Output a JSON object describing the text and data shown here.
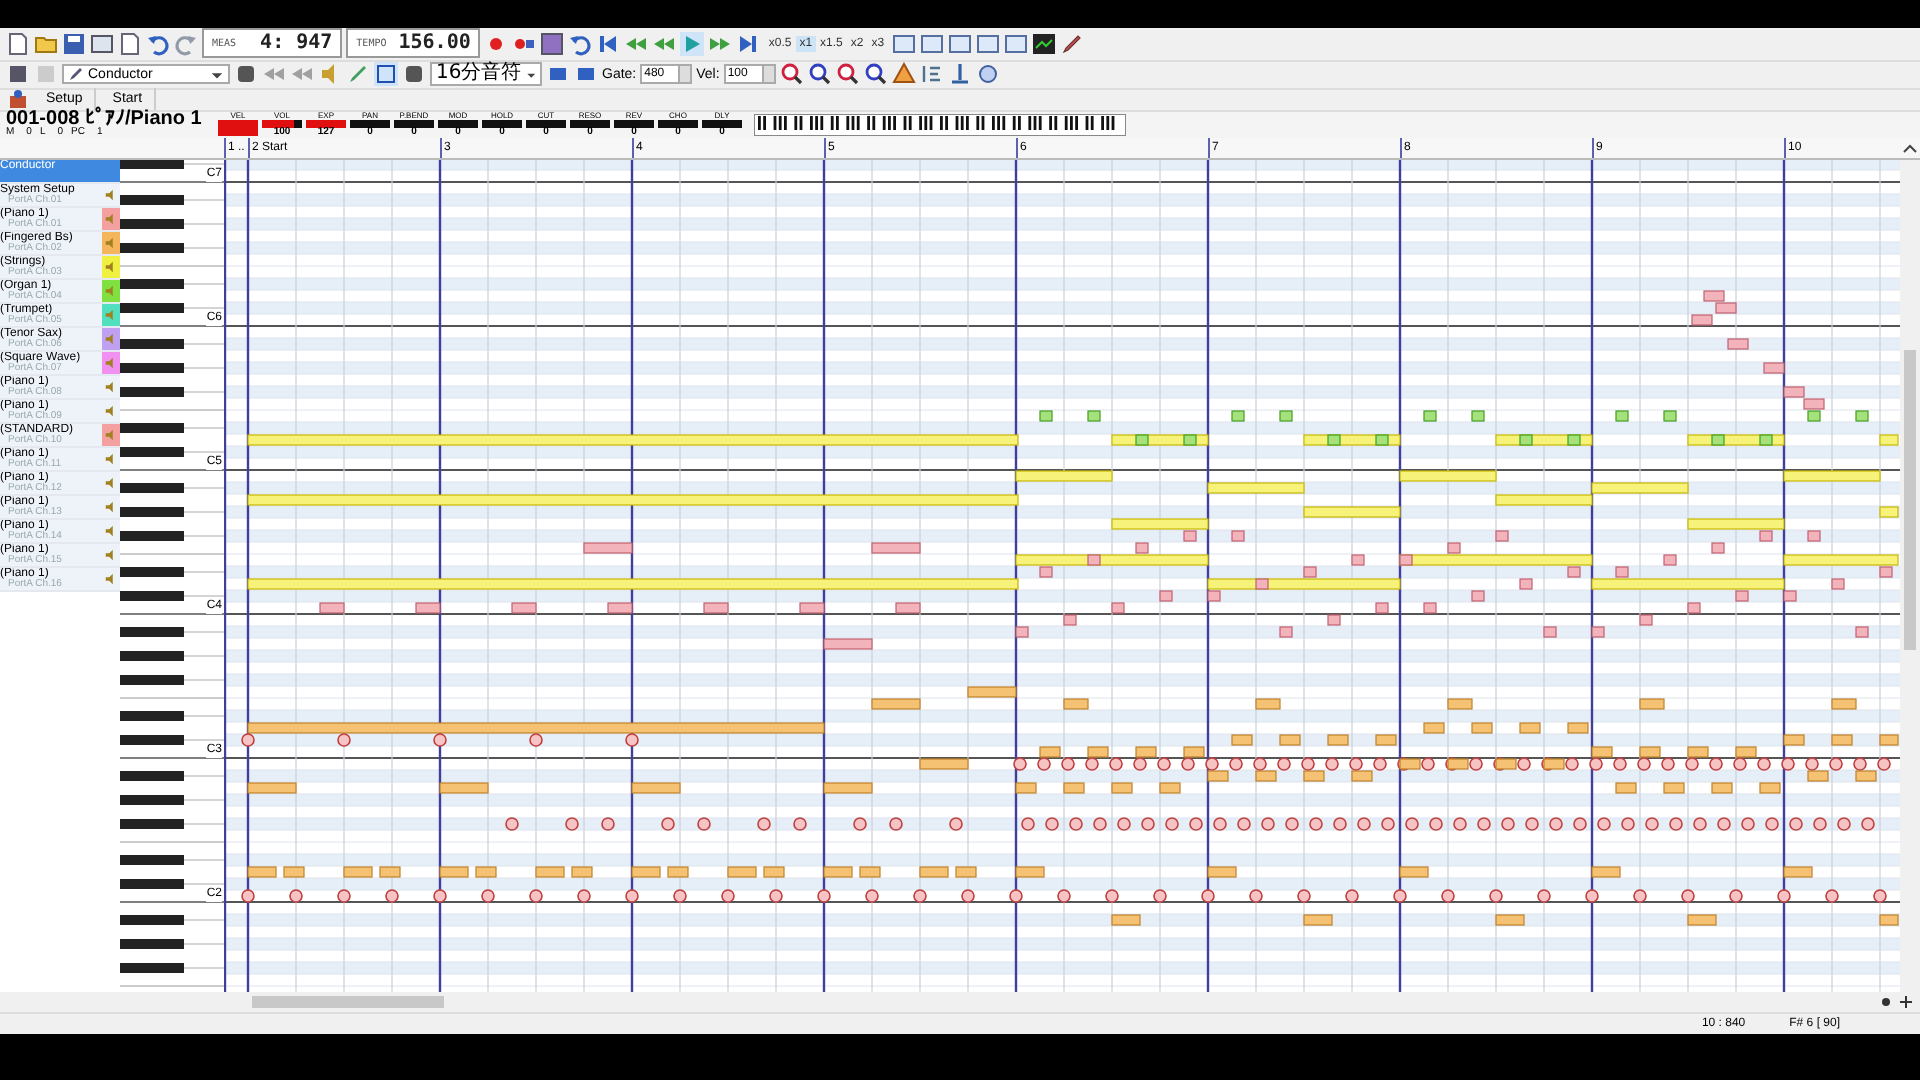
{
  "toolbar": {
    "measure_label": "MEAS",
    "measure": "4: 947",
    "tempo_label": "TEMPO",
    "tempo": "156.00",
    "speeds": [
      {
        "label": "x0.5",
        "selected": false
      },
      {
        "label": "x1",
        "selected": true
      },
      {
        "label": "x1.5",
        "selected": false
      },
      {
        "label": "x2",
        "selected": false
      },
      {
        "label": "x3",
        "selected": false
      }
    ]
  },
  "edit_bar": {
    "track": "Conductor",
    "note_length": "16分音符",
    "gate_label": "Gate:",
    "gate": "480",
    "vel_label": "Vel:",
    "vel": "100"
  },
  "markers": [
    {
      "label": "Setup"
    },
    {
      "label": "Start"
    }
  ],
  "channel_panel": {
    "title": "001-008 ﾋﾟｱﾉ/Piano 1",
    "fields": [
      {
        "label": "M",
        "value": "0"
      },
      {
        "label": "L",
        "value": "0"
      },
      {
        "label": "PC",
        "value": "1"
      }
    ],
    "controls": [
      {
        "label": "VEL",
        "level": 1
      },
      {
        "label": "VOL",
        "value": "100",
        "level": 0.79
      },
      {
        "label": "EXP",
        "value": "127",
        "level": 1
      },
      {
        "label": "PAN",
        "value": "0",
        "level": 0
      },
      {
        "label": "P.BEND",
        "value": "0",
        "level": 0
      },
      {
        "label": "MOD",
        "value": "0",
        "level": 0
      },
      {
        "label": "HOLD",
        "value": "0",
        "level": 0
      },
      {
        "label": "CUT",
        "value": "0",
        "level": 0
      },
      {
        "label": "RESO",
        "value": "0",
        "level": 0
      },
      {
        "label": "REV",
        "value": "0",
        "level": 0
      },
      {
        "label": "CHO",
        "value": "0",
        "level": 0
      },
      {
        "label": "DLY",
        "value": "0",
        "level": 0
      }
    ]
  },
  "tracks": [
    {
      "name": "Conductor",
      "selected": true
    },
    {
      "name": "System Setup",
      "port": "PortA  Ch.01",
      "selected": false
    },
    {
      "name": "(Piano 1)",
      "port": "PortA  Ch.01",
      "selected": false,
      "color": "#f4a0a0"
    },
    {
      "name": "(Fingered Bs)",
      "port": "PortA  Ch.02",
      "selected": false,
      "color": "#f5b55a"
    },
    {
      "name": "(Strings)",
      "port": "PortA  Ch.03",
      "selected": false,
      "color": "#f0f040"
    },
    {
      "name": "(Organ 1)",
      "port": "PortA  Ch.04",
      "selected": false,
      "color": "#80e040"
    },
    {
      "name": "(Trumpet)",
      "port": "PortA  Ch.05",
      "selected": false,
      "color": "#50e0c0"
    },
    {
      "name": "(Tenor Sax)",
      "port": "PortA  Ch.06",
      "selected": false,
      "color": "#c0a0f0"
    },
    {
      "name": "(Square Wave)",
      "port": "PortA  Ch.07",
      "selected": false,
      "color": "#f090f0"
    },
    {
      "name": "(Piano 1)",
      "port": "PortA  Ch.08",
      "selected": false
    },
    {
      "name": "(Piano 1)",
      "port": "PortA  Ch.09",
      "selected": false
    },
    {
      "name": "(STANDARD)",
      "port": "PortA  Ch.10",
      "selected": false,
      "color": "#f4a0a0"
    },
    {
      "name": "(Piano 1)",
      "port": "PortA  Ch.11",
      "selected": false
    },
    {
      "name": "(Piano 1)",
      "port": "PortA  Ch.12",
      "selected": false
    },
    {
      "name": "(Piano 1)",
      "port": "PortA  Ch.13",
      "selected": false
    },
    {
      "name": "(Piano 1)",
      "port": "PortA  Ch.14",
      "selected": false
    },
    {
      "name": "(Piano 1)",
      "port": "PortA  Ch.15",
      "selected": false
    },
    {
      "name": "(Piano 1)",
      "port": "PortA  Ch.16",
      "selected": false
    }
  ],
  "measures": [
    {
      "label": "1 .."
    },
    {
      "label": "2 Start"
    },
    {
      "label": "3"
    },
    {
      "label": "4"
    },
    {
      "label": "5"
    },
    {
      "label": "6"
    },
    {
      "label": "7"
    },
    {
      "label": "8"
    },
    {
      "label": "9"
    },
    {
      "label": "10"
    }
  ],
  "octaves": [
    {
      "label": "C7"
    },
    {
      "label": "C6"
    },
    {
      "label": "C5"
    },
    {
      "label": "C4"
    },
    {
      "label": "C3"
    },
    {
      "label": "C2"
    }
  ],
  "status_bar": {
    "position": "10 : 840",
    "pitch": "F# 6 [ 90]"
  }
}
